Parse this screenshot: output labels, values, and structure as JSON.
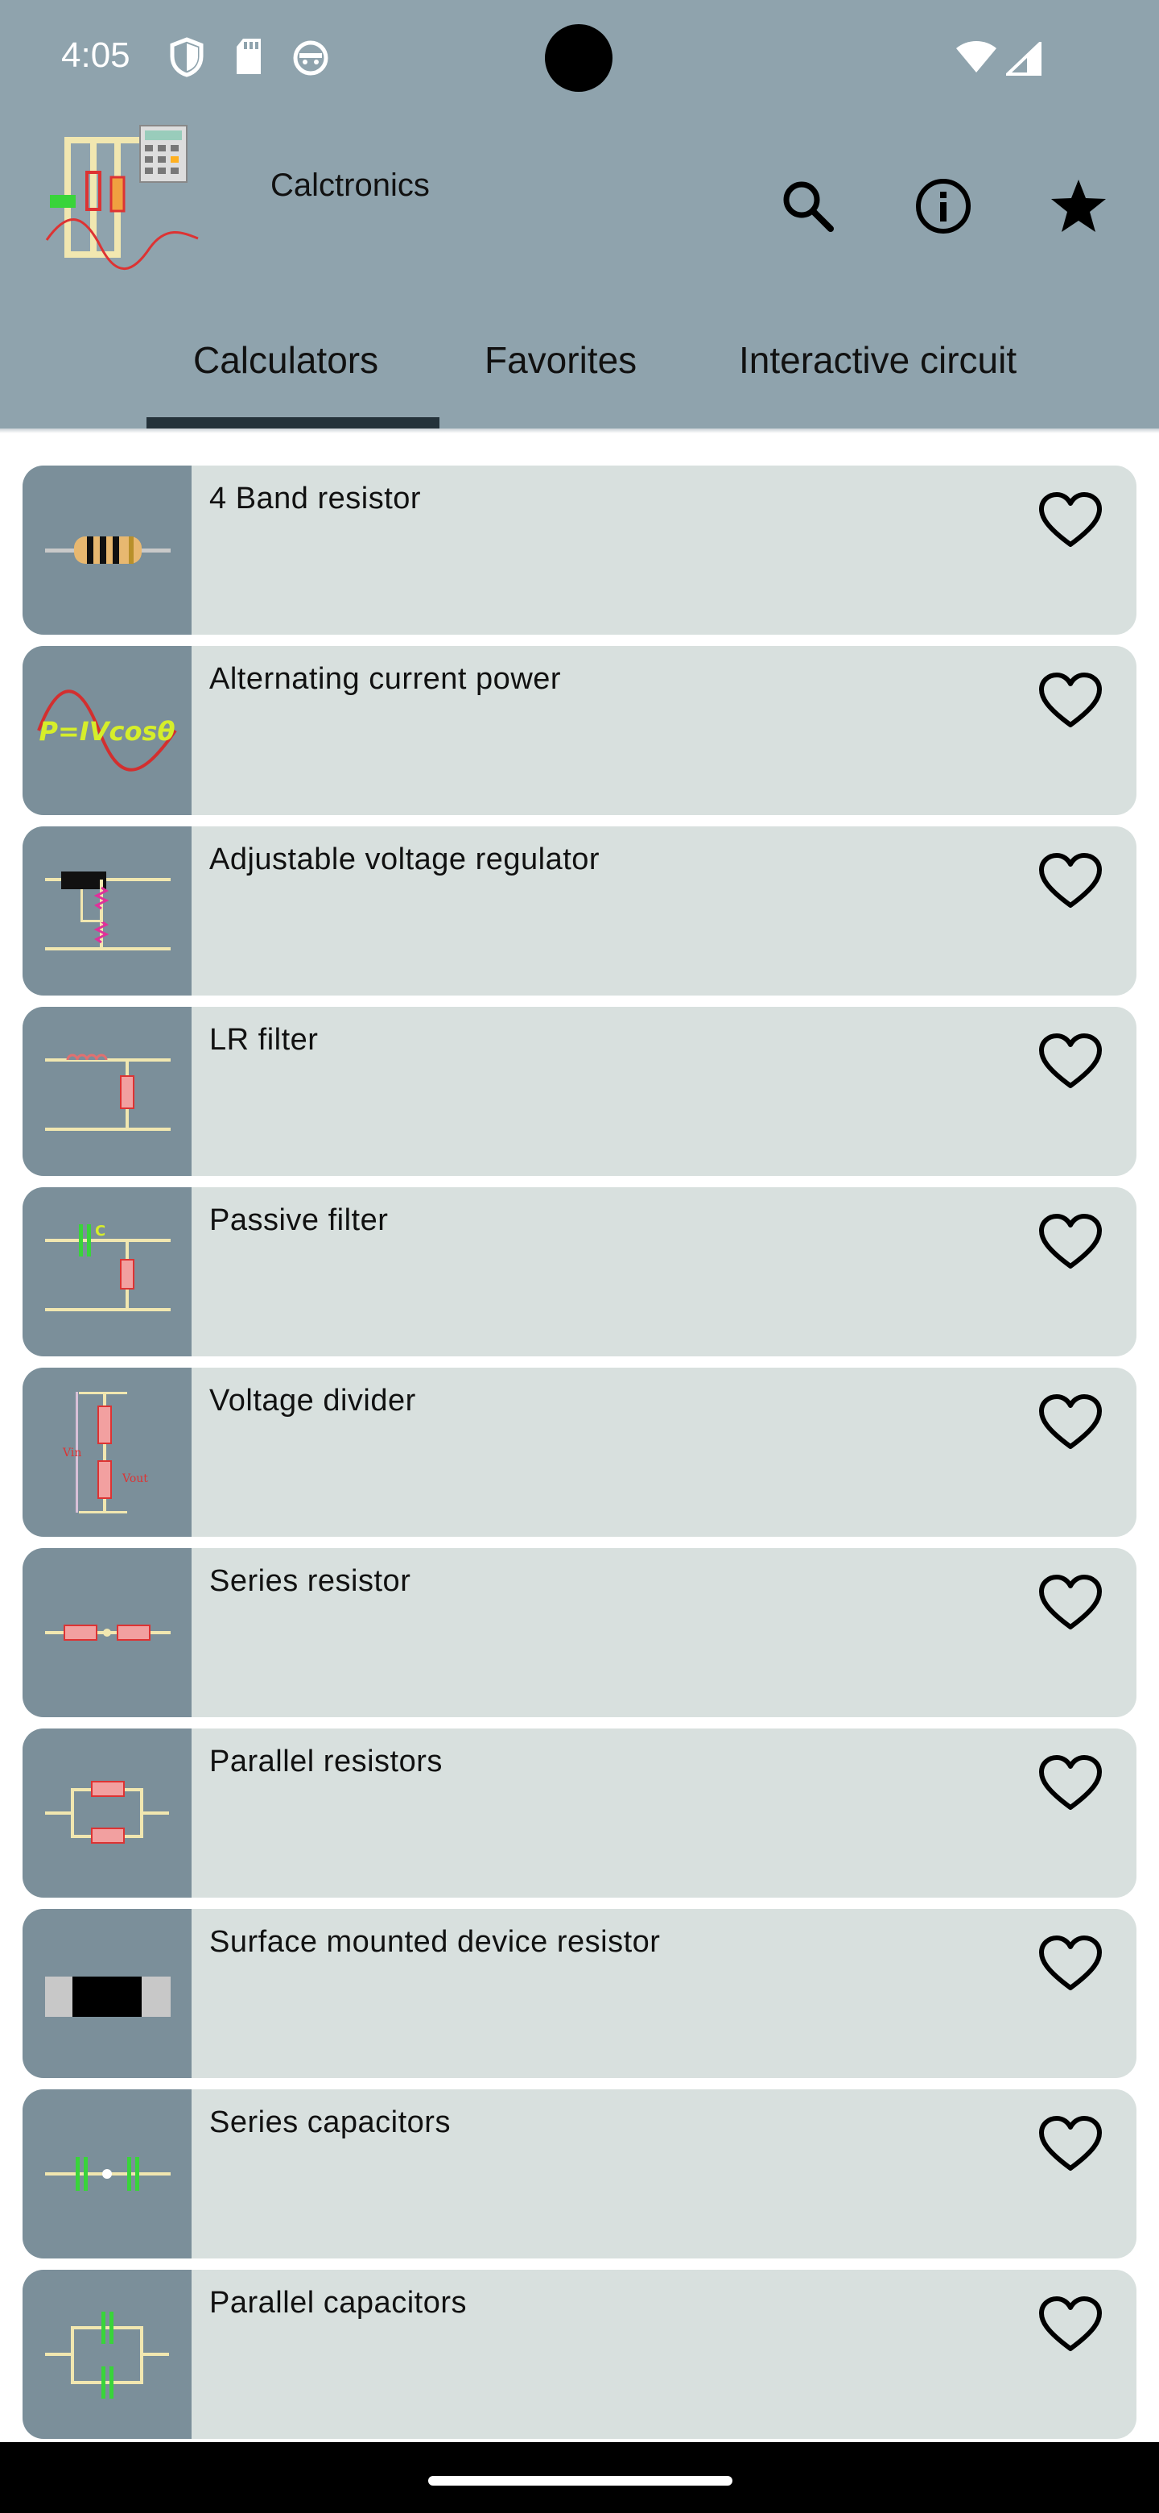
{
  "status_bar": {
    "time": "4:05"
  },
  "app": {
    "title": "Calctronics"
  },
  "tabs": [
    {
      "label": "Calculators",
      "selected": true
    },
    {
      "label": "Favorites",
      "selected": false
    },
    {
      "label": "Interactive circuit",
      "selected": false
    }
  ],
  "calculators": [
    {
      "title": "4 Band resistor",
      "icon": "four-band-resistor-icon"
    },
    {
      "title": "Alternating current power",
      "icon": "ac-power-formula-icon"
    },
    {
      "title": "Adjustable voltage regulator",
      "icon": "voltage-regulator-icon"
    },
    {
      "title": "LR filter",
      "icon": "lr-filter-icon"
    },
    {
      "title": "Passive filter",
      "icon": "passive-filter-icon"
    },
    {
      "title": "Voltage divider",
      "icon": "voltage-divider-icon"
    },
    {
      "title": "Series resistor",
      "icon": "series-resistor-icon"
    },
    {
      "title": "Parallel resistors",
      "icon": "parallel-resistors-icon"
    },
    {
      "title": "Surface mounted device resistor",
      "icon": "smd-resistor-icon"
    },
    {
      "title": "Series capacitors",
      "icon": "series-capacitors-icon"
    },
    {
      "title": "Parallel capacitors",
      "icon": "parallel-capacitors-icon"
    }
  ],
  "thumb_text": {
    "ac_formula": "P=IVcosθ",
    "capacitor_letter": "C",
    "vin": "Vin",
    "vout": "Vout"
  },
  "colors": {
    "appbar": "#8fa3ad",
    "card": "#d8e0de",
    "thumb": "#7b8f9a",
    "tab_indicator": "#24323a"
  }
}
